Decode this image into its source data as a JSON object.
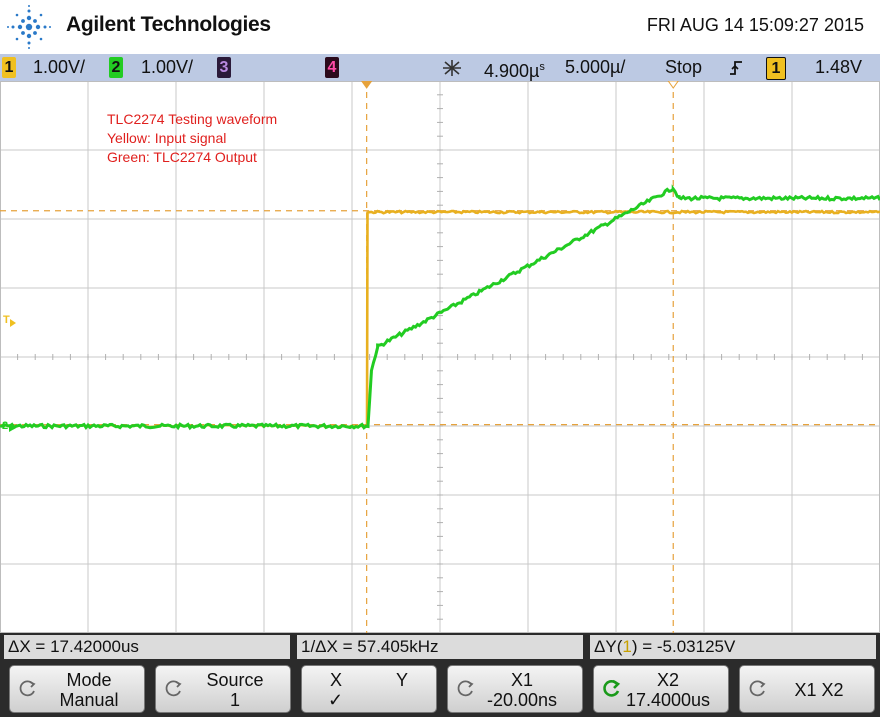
{
  "header": {
    "brand": "Agilent Technologies",
    "datetime": "FRI AUG 14 15:09:27 2015"
  },
  "statusbar": {
    "ch1_num": "1",
    "ch1_scale": "1.00V/",
    "ch2_num": "2",
    "ch2_scale": "1.00V/",
    "ch3_num": "3",
    "ch4_num": "4",
    "time_delay": "4.900µ",
    "time_delay_unit": "s",
    "time_scale": "5.000µ/",
    "run_state": "Stop",
    "trigger_slope_icon": "rising-edge-icon",
    "trigger_source": "1",
    "trigger_level": "1.48V"
  },
  "annotation": {
    "line1": "TLC2274 Testing waveform",
    "line2": "Yellow: Input signal",
    "line3": "Green: TLC2274 Output"
  },
  "markers": {
    "trigger_level_marker": "T",
    "ch2_ground_marker": "2"
  },
  "readouts": {
    "delta_x": "ΔX = 17.42000us",
    "inv_delta_x": "1/ΔX = 57.405kHz",
    "delta_y_prefix": "ΔY(",
    "delta_y_channel": "1",
    "delta_y_suffix": ") = -5.03125V"
  },
  "softkeys": {
    "mode_label": "Mode",
    "mode_value": "Manual",
    "source_label": "Source",
    "source_value": "1",
    "x_label": "X",
    "y_label": "Y",
    "xy_check": "✓",
    "x1_label": "X1",
    "x1_value": "-20.00ns",
    "x2_label": "X2",
    "x2_value": "17.4000us",
    "x1x2_label": "X1 X2"
  },
  "colors": {
    "ch1": "#f0c020",
    "ch2": "#22cc22",
    "ch3": "#7a3fb0",
    "ch4": "#e0208a",
    "annotation": "#e0201e",
    "cursor": "#e6a23c",
    "statusbar": "#bcc9e3"
  },
  "waveforms": {
    "time_per_div_us": 5.0,
    "volts_per_div": 1.0,
    "ch1_input": {
      "low_v": 0.0,
      "high_v": 3.1,
      "step_time_us": 0.0
    },
    "ch2_output": {
      "start_v": 0.0,
      "knee_time_us": 0.6,
      "knee_v": 1.15,
      "plateau_time_us": 17.4,
      "plateau_v": 3.3
    }
  }
}
